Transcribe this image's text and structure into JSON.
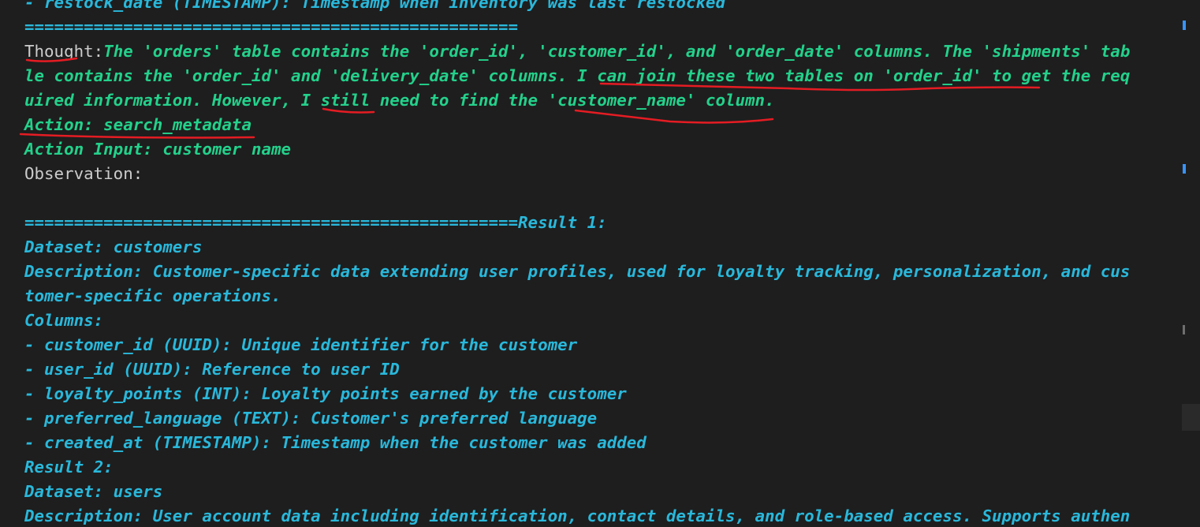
{
  "terminal": {
    "lines": [
      {
        "segments": [
          {
            "text": "- restock_date (TIMESTAMP): Timestamp when inventory was last restocked",
            "style": "blue"
          }
        ]
      },
      {
        "segments": [
          {
            "text": "==================================================",
            "style": "blue"
          }
        ]
      },
      {
        "segments": [
          {
            "text": "Thought",
            "style": "plain"
          },
          {
            "text": ":",
            "style": "plain"
          },
          {
            "text": "The 'orders' table contains the 'order_id', 'customer_id', and 'order_date' columns. The 'shipments' tab",
            "style": "green"
          }
        ]
      },
      {
        "segments": [
          {
            "text": "le contains the 'order_id' and 'delivery_date' columns. I can join these two tables on 'order_id' to get the req",
            "style": "green"
          }
        ]
      },
      {
        "segments": [
          {
            "text": "uired information. However, I still need to find the 'customer_name' column.",
            "style": "green"
          }
        ]
      },
      {
        "segments": [
          {
            "text": "Action: search_metadata",
            "style": "green"
          }
        ]
      },
      {
        "segments": [
          {
            "text": "Action Input: customer name",
            "style": "green"
          }
        ]
      },
      {
        "segments": [
          {
            "text": "Observation:",
            "style": "plain"
          }
        ]
      },
      {
        "segments": [
          {
            "text": "",
            "style": "plain"
          }
        ]
      },
      {
        "segments": [
          {
            "text": "==================================================Result 1:",
            "style": "blue"
          }
        ]
      },
      {
        "segments": [
          {
            "text": "Dataset: customers",
            "style": "blue"
          }
        ]
      },
      {
        "segments": [
          {
            "text": "Description: Customer-specific data extending user profiles, used for loyalty tracking, personalization, and cus",
            "style": "blue"
          }
        ]
      },
      {
        "segments": [
          {
            "text": "tomer-specific operations.",
            "style": "blue"
          }
        ]
      },
      {
        "segments": [
          {
            "text": "Columns:",
            "style": "blue"
          }
        ]
      },
      {
        "segments": [
          {
            "text": "- customer_id (UUID): Unique identifier for the customer",
            "style": "blue"
          }
        ]
      },
      {
        "segments": [
          {
            "text": "- user_id (UUID): Reference to user ID",
            "style": "blue"
          }
        ]
      },
      {
        "segments": [
          {
            "text": "- loyalty_points (INT): Loyalty points earned by the customer",
            "style": "blue"
          }
        ]
      },
      {
        "segments": [
          {
            "text": "- preferred_language (TEXT): Customer's preferred language",
            "style": "blue"
          }
        ]
      },
      {
        "segments": [
          {
            "text": "- created_at (TIMESTAMP): Timestamp when the customer was added",
            "style": "blue"
          }
        ]
      },
      {
        "segments": [
          {
            "text": "Result 2:",
            "style": "blue"
          }
        ]
      },
      {
        "segments": [
          {
            "text": "Dataset: users",
            "style": "blue"
          }
        ]
      },
      {
        "segments": [
          {
            "text": "Description: User account data including identification, contact details, and role-based access. Supports authen",
            "style": "blue"
          }
        ]
      }
    ]
  },
  "colors": {
    "background": "#1e1e1e",
    "green": "#23d18b",
    "blue": "#29b8db",
    "plain": "#cccccc",
    "annotation": "#e51c23",
    "ruler_mark": "#3794ff"
  }
}
